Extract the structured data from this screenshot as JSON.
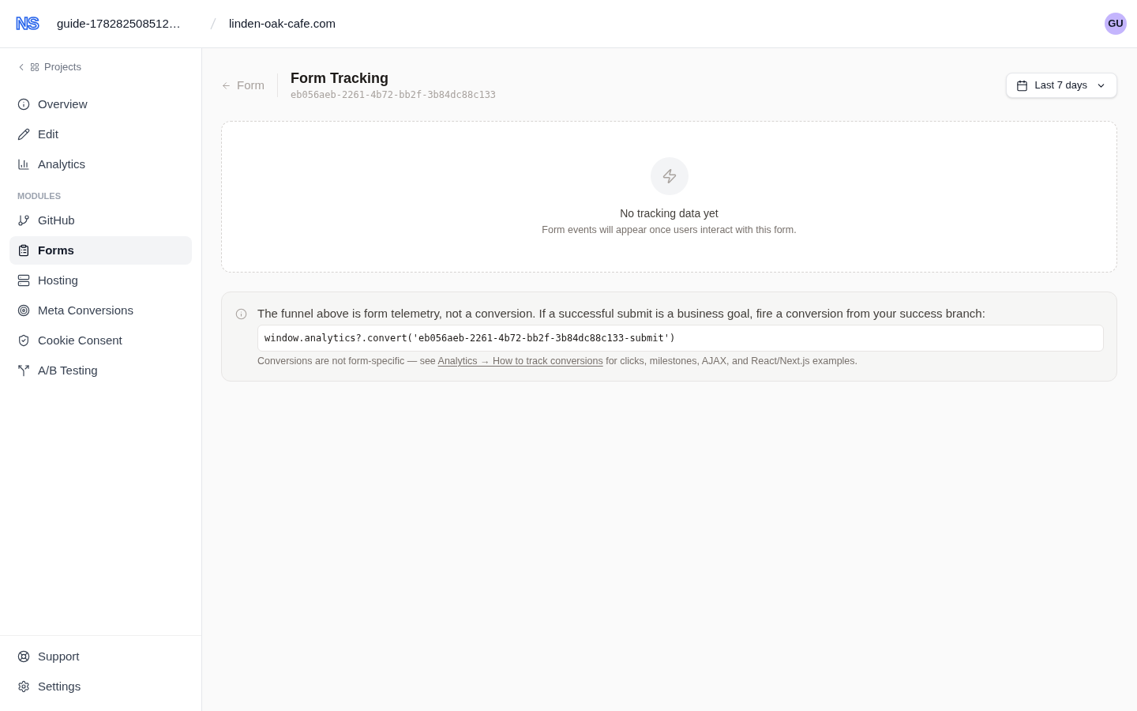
{
  "header": {
    "logo": "NS",
    "project": "guide-178282508512…",
    "site": "linden-oak-cafe.com",
    "avatar": "GU"
  },
  "sidebar": {
    "back_link": "Projects",
    "nav": [
      {
        "label": "Overview",
        "selected": false
      },
      {
        "label": "Edit",
        "selected": false
      },
      {
        "label": "Analytics",
        "selected": false
      }
    ],
    "modules": {
      "heading": "MODULES",
      "items": [
        {
          "label": "GitHub",
          "selected": false
        },
        {
          "label": "Forms",
          "selected": true
        },
        {
          "label": "Hosting",
          "selected": false
        },
        {
          "label": "Meta Conversions",
          "selected": false
        },
        {
          "label": "Cookie Consent",
          "selected": false
        },
        {
          "label": "A/B Testing",
          "selected": false
        }
      ]
    },
    "footer": [
      {
        "label": "Support",
        "selected": false
      },
      {
        "label": "Settings",
        "selected": false
      }
    ]
  },
  "page": {
    "back_link": "Form",
    "title": "Form Tracking",
    "id": "eb056aeb-2261-4b72-bb2f-3b84dc88c133",
    "date_range": "Last 7 days"
  },
  "empty_state": {
    "title": "No tracking data yet",
    "text": "Form events will appear once users interact with this form."
  },
  "notice": {
    "text": "The funnel above is form telemetry, not a conversion. If a successful submit is a business goal, fire a conversion from your success branch:",
    "code": "window.analytics?.convert('eb056aeb-2261-4b72-bb2f-3b84dc88c133-submit')",
    "note_before": "Conversions are not form-specific — see ",
    "note_link": "Analytics → How to track conversions",
    "note_after": " for clicks, milestones, AJAX, and React/Next.js examples."
  }
}
